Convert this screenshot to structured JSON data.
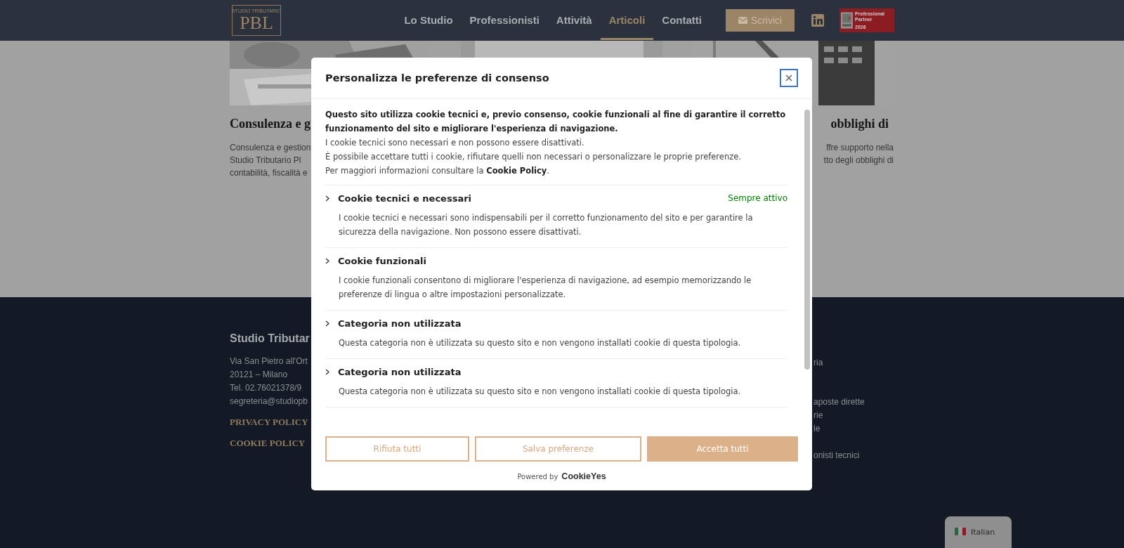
{
  "header": {
    "logo": {
      "top": "STUDIO TRIBUTARIO",
      "mark": "PBL"
    },
    "nav": [
      {
        "label": "Lo Studio",
        "selected": false
      },
      {
        "label": "Professionisti",
        "selected": false
      },
      {
        "label": "Attività",
        "selected": false
      },
      {
        "label": "Articoli",
        "selected": true
      },
      {
        "label": "Contatti",
        "selected": false
      }
    ],
    "contact_button": "Scrivici",
    "badge": {
      "title": "Professional Partner",
      "year": "2026"
    }
  },
  "cards": [
    {
      "kind": "picture",
      "title": "Consulenza e g",
      "text": [
        "Consulenza e gestion",
        "Studio Tributario Pl",
        "contabilità, fiscalità e"
      ]
    },
    {
      "kind": "picture"
    },
    {
      "kind": "picture",
      "title": "obblighi di",
      "text": [
        "ffre supporto nella",
        "tto degli obblighi di"
      ]
    }
  ],
  "footer": {
    "title": "Studio Tributar",
    "lines": [
      "Via San Pietro all'Ort",
      "20121 – Milano",
      "Tel. 02.76021378/9",
      "segreteria@studiopb"
    ],
    "links": [
      "PRIVACY POLICY",
      "COOKIE POLICY"
    ],
    "right_groups": [
      [
        "ria"
      ],
      [
        "aposte dirette",
        "rie",
        "le"
      ],
      [
        "onisti tecnici"
      ]
    ]
  },
  "consent_modal": {
    "title": "Personalizza le preferenze di consenso",
    "intro": [
      "**Questo sito utilizza cookie tecnici e, previo consenso, cookie funzionali al fine di garantire il corretto funzionamento del sito e migliorare l'esperienza di navigazione.**",
      "I cookie tecnici sono necessari e non possono essere disattivati.",
      "È possibile accettare tutti i cookie, rifiutare quelli non necessari o personalizzare le proprie preferenze.",
      "Per maggiori informazioni consultare la **Cookie Policy**."
    ],
    "categories": [
      {
        "title": "Cookie tecnici e necessari",
        "status": "Sempre attivo",
        "description": "I cookie tecnici e necessari sono indispensabili per il corretto funzionamento del sito e per garantire la sicurezza della navigazione. Non possono essere disattivati."
      },
      {
        "title": "Cookie funzionali",
        "description": "I cookie funzionali consentono di migliorare l'esperienza di navigazione, ad esempio memorizzando le preferenze di lingua o altre impostazioni personalizzate."
      },
      {
        "title": "Categoria non utilizzata",
        "description": "Questa categoria non è utilizzata su questo sito e non vengono installati cookie di questa tipologia."
      },
      {
        "title": "Categoria non utilizzata",
        "description": "Questa categoria non è utilizzata su questo sito e non vengono installati cookie di questa tipologia."
      }
    ],
    "buttons": [
      {
        "label": "Rifiuta tutti",
        "kind": "outline"
      },
      {
        "label": "Salva preferenze",
        "kind": "outline"
      },
      {
        "label": "Accetta tutti",
        "kind": "filled"
      }
    ],
    "powered_by": "Powered by",
    "brand": "CookieYes"
  },
  "language": {
    "label": "Italian"
  }
}
